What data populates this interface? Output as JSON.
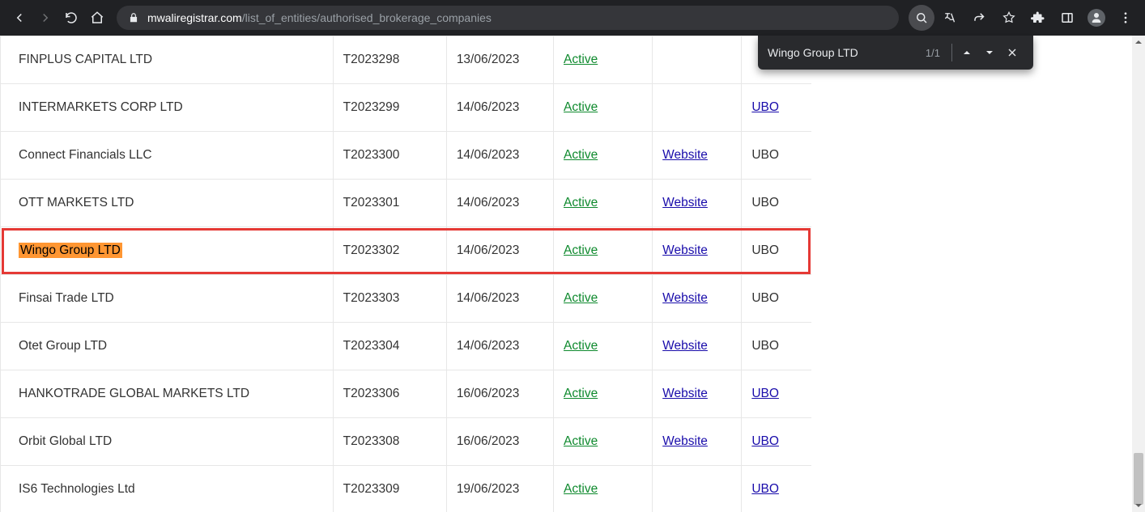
{
  "browser": {
    "url_domain": "mwaliregistrar.com",
    "url_path": "/list_of_entities/authorised_brokerage_companies"
  },
  "find": {
    "query": "Wingo Group LTD",
    "count": "1/1"
  },
  "status_label": "Active",
  "website_label": "Website",
  "ubo_label": "UBO",
  "rows": [
    {
      "name": "FINPLUS CAPITAL LTD",
      "licence": "T2023298",
      "date": "13/06/2023",
      "website": false,
      "ubo_link": false,
      "ubo_shown": false,
      "hit": false
    },
    {
      "name": "INTERMARKETS CORP LTD",
      "licence": "T2023299",
      "date": "14/06/2023",
      "website": false,
      "ubo_link": true,
      "ubo_shown": true,
      "hit": false
    },
    {
      "name": "Connect Financials LLC",
      "licence": "T2023300",
      "date": "14/06/2023",
      "website": true,
      "ubo_link": false,
      "ubo_shown": true,
      "hit": false
    },
    {
      "name": "OTT MARKETS LTD",
      "licence": "T2023301",
      "date": "14/06/2023",
      "website": true,
      "ubo_link": false,
      "ubo_shown": true,
      "hit": false
    },
    {
      "name": "Wingo Group LTD",
      "licence": "T2023302",
      "date": "14/06/2023",
      "website": true,
      "ubo_link": false,
      "ubo_shown": true,
      "hit": true
    },
    {
      "name": "Finsai Trade LTD",
      "licence": "T2023303",
      "date": "14/06/2023",
      "website": true,
      "ubo_link": false,
      "ubo_shown": true,
      "hit": false
    },
    {
      "name": "Otet Group LTD",
      "licence": "T2023304",
      "date": "14/06/2023",
      "website": true,
      "ubo_link": false,
      "ubo_shown": true,
      "hit": false
    },
    {
      "name": "HANKOTRADE GLOBAL MARKETS LTD",
      "licence": "T2023306",
      "date": "16/06/2023",
      "website": true,
      "ubo_link": true,
      "ubo_shown": true,
      "hit": false
    },
    {
      "name": "Orbit Global LTD",
      "licence": "T2023308",
      "date": "16/06/2023",
      "website": true,
      "ubo_link": true,
      "ubo_shown": true,
      "hit": false
    },
    {
      "name": "IS6 Technologies Ltd",
      "licence": "T2023309",
      "date": "19/06/2023",
      "website": false,
      "ubo_link": true,
      "ubo_shown": true,
      "hit": false
    }
  ]
}
